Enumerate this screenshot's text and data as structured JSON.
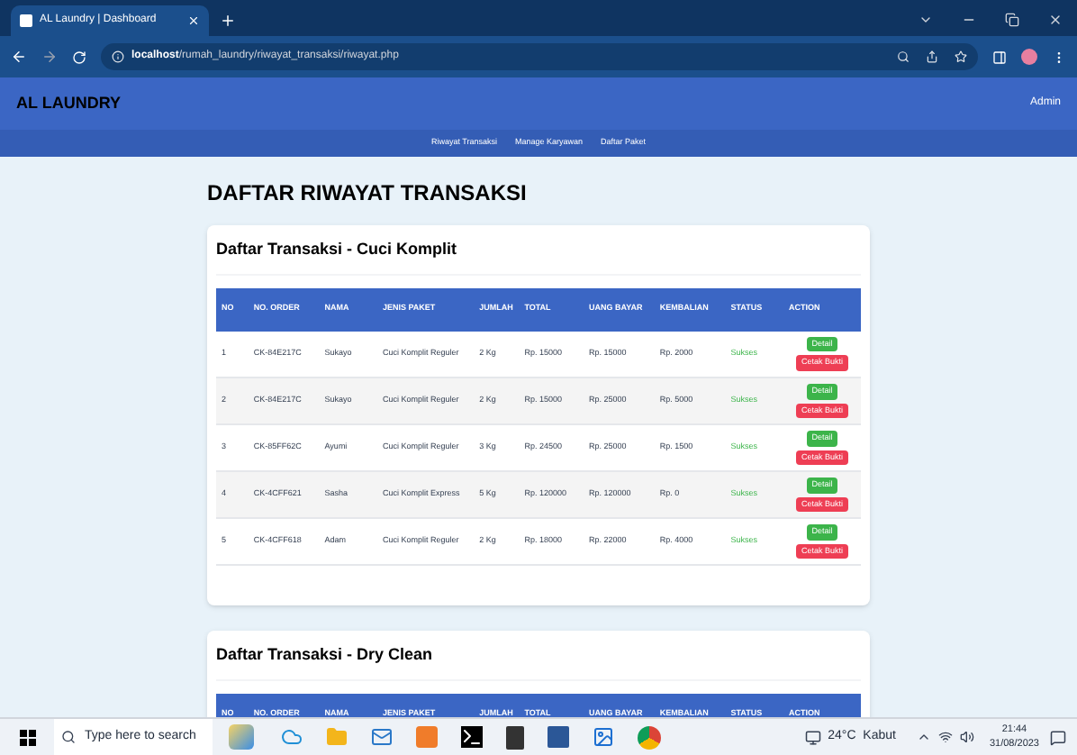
{
  "browser": {
    "tab_title": "AL Laundry | Dashboard",
    "url_host": "localhost",
    "url_path": "/rumah_laundry/riwayat_transaksi/riwayat.php"
  },
  "navbar": {
    "brand": "AL LAUNDRY",
    "user": "Admin",
    "links": [
      "Riwayat Transaksi",
      "Manage Karyawan",
      "Daftar Paket"
    ]
  },
  "page_title": "DAFTAR RIWAYAT TRANSAKSI",
  "sections": [
    {
      "title": "Daftar Transaksi - Cuci Komplit",
      "columns": [
        "NO",
        "NO. ORDER",
        "NAMA",
        "JENIS PAKET",
        "JUMLAH",
        "TOTAL",
        "UANG BAYAR",
        "KEMBALIAN",
        "STATUS",
        "ACTION"
      ],
      "rows": [
        {
          "cells": [
            "1",
            "CK-84E217C",
            "Sukayo",
            "Cuci Komplit Reguler",
            "2 Kg",
            "Rp. 15000",
            "Rp. 15000",
            "Rp. 2000"
          ],
          "status": "Sukses",
          "actions": [
            "Detail",
            "Cetak Bukti"
          ]
        },
        {
          "cells": [
            "2",
            "CK-84E217C",
            "Sukayo",
            "Cuci Komplit Reguler",
            "2 Kg",
            "Rp. 15000",
            "Rp. 25000",
            "Rp. 5000"
          ],
          "status": "Sukses",
          "actions": [
            "Detail",
            "Cetak Bukti"
          ]
        },
        {
          "cells": [
            "3",
            "CK-85FF62C",
            "Ayumi",
            "Cuci Komplit Reguler",
            "3 Kg",
            "Rp. 24500",
            "Rp. 25000",
            "Rp. 1500"
          ],
          "status": "Sukses",
          "actions": [
            "Detail",
            "Cetak Bukti"
          ]
        },
        {
          "cells": [
            "4",
            "CK-4CFF621",
            "Sasha",
            "Cuci Komplit Express",
            "5 Kg",
            "Rp. 120000",
            "Rp. 120000",
            "Rp. 0"
          ],
          "status": "Sukses",
          "actions": [
            "Detail",
            "Cetak Bukti"
          ]
        },
        {
          "cells": [
            "5",
            "CK-4CFF618",
            "Adam",
            "Cuci Komplit Reguler",
            "2 Kg",
            "Rp. 18000",
            "Rp. 22000",
            "Rp. 4000"
          ],
          "status": "Sukses",
          "actions": [
            "Detail",
            "Cetak Bukti"
          ]
        }
      ]
    },
    {
      "title": "Daftar Transaksi - Dry Clean",
      "columns": [
        "NO",
        "NO. ORDER",
        "NAMA",
        "JENIS PAKET",
        "JUMLAH",
        "TOTAL",
        "UANG BAYAR",
        "KEMBALIAN",
        "STATUS",
        "ACTION"
      ]
    }
  ],
  "taskbar": {
    "search_placeholder": "Type here to search",
    "weather": "24°C  Kabut",
    "time": "21:44",
    "date": "31/08/2023"
  }
}
